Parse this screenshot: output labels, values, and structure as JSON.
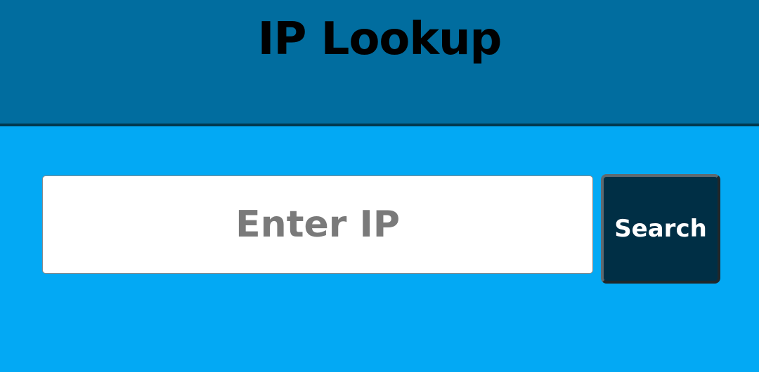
{
  "header": {
    "title": "IP Lookup"
  },
  "search": {
    "placeholder": "Enter IP",
    "value": "",
    "button_label": "Search"
  },
  "colors": {
    "header_background": "#016d9f",
    "page_background": "#03a9f4",
    "button_background": "#002f45"
  }
}
